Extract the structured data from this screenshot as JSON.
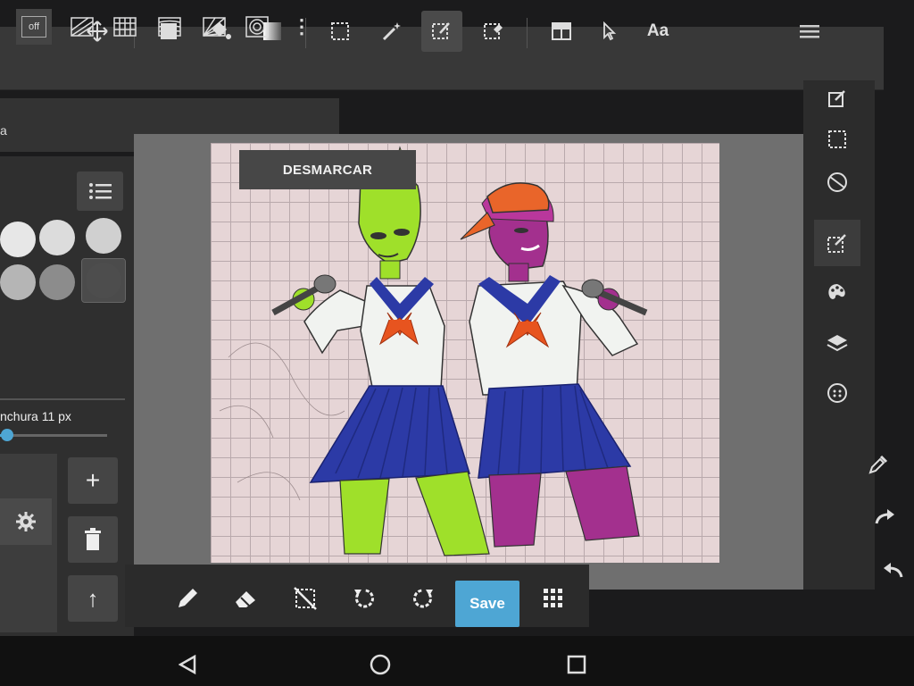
{
  "colors": {
    "accent": "#4ea6d4",
    "toolbar_bg": "#383838",
    "panel_bg": "#2f2f2f",
    "canvas_bg": "#e6d5d6",
    "alien_green": "#9fe02a",
    "purple_skin": "#a3308e",
    "skirt_blue": "#2c3aa6",
    "scarf_orange": "#e7541f",
    "cap_orange": "#e9652a"
  },
  "top_toolbar": {
    "icons": [
      "square-outline-icon",
      "move-icon",
      "fill-square-icon",
      "paint-bucket-icon",
      "gradient-icon",
      "select-rect-icon",
      "magic-wand-icon",
      "select-pen-icon",
      "select-eraser-icon",
      "layout-icon",
      "pointer-icon",
      "text-icon",
      "menu-icon"
    ],
    "text_tool_label": "Aa"
  },
  "sub_toolbar": {
    "partial_label": "a",
    "off_label": "off",
    "icons": [
      "hatch-icon",
      "grid-icon",
      "perspective-icon",
      "radial-icon",
      "concentric-icon",
      "more-vertical-icon"
    ],
    "more_glyph": "⋮"
  },
  "left_panel": {
    "list_icon": "list-icon",
    "swatches": [
      "#e7e7e7",
      "#dcdcdc",
      "#d0d0d0",
      "#b5b5b5",
      "#8c8c8c",
      "#4d4d4d"
    ],
    "brush_width_label": "nchura 11 px",
    "slider_value": 0.03,
    "add_glyph": "+",
    "up_glyph": "↑"
  },
  "overlay": {
    "deselect_label": "DESMARCAR"
  },
  "bottom_toolbar": {
    "save_label": "Save",
    "icons": [
      "pencil-icon",
      "eraser-icon",
      "clear-selection-icon",
      "undo-icon",
      "redo-icon",
      "grid-dots-icon"
    ]
  },
  "right_panel": {
    "icons": [
      "edit-icon",
      "select-icon",
      "transform-icon",
      "brush-icon",
      "palette-icon",
      "layers-icon",
      "filter-icon",
      "eyedropper-icon",
      "redo-arrow-icon",
      "undo-arrow-icon"
    ]
  }
}
